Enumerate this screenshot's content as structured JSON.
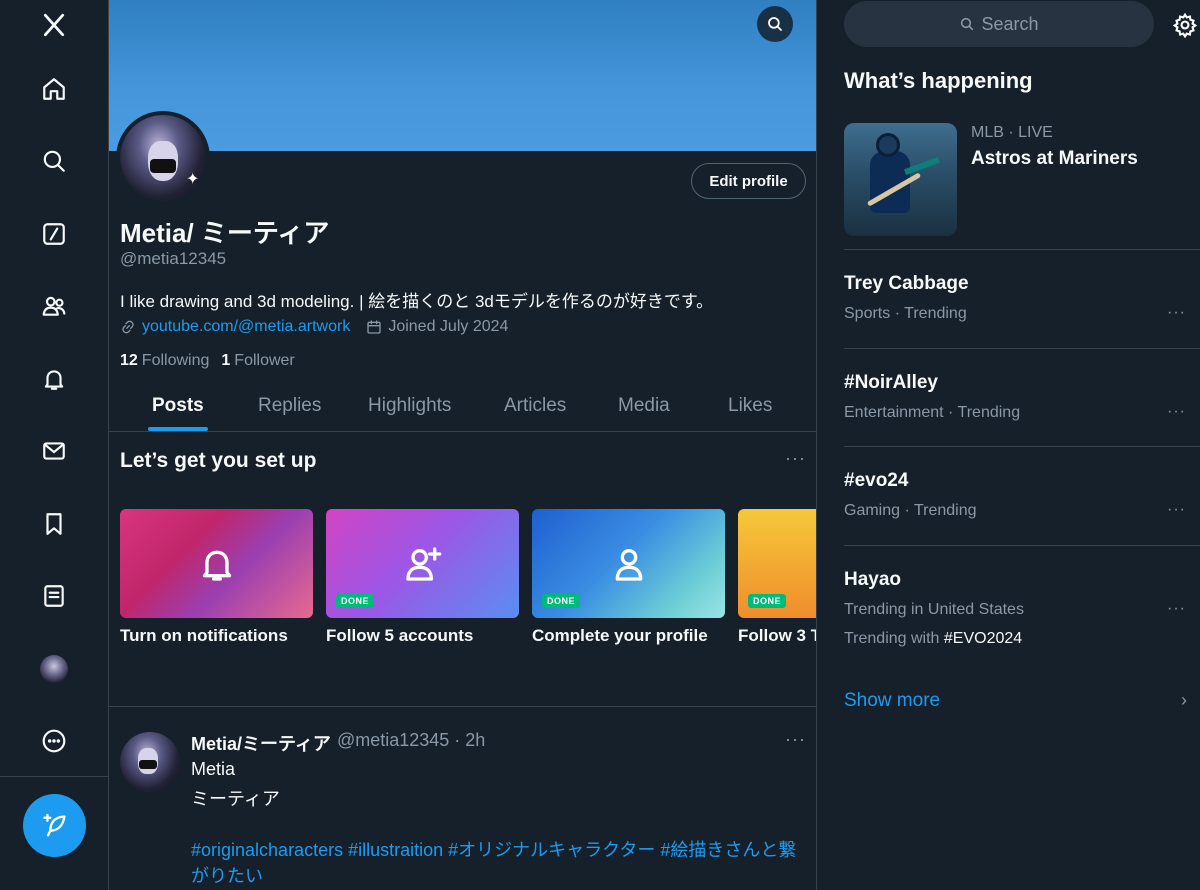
{
  "nav": {
    "compose_label": "Post"
  },
  "profile": {
    "display_name": "Metia/ ミーティア",
    "handle": "@metia12345",
    "bio": "I like drawing and 3d modeling. | 絵を描くのと 3dモデルを作るのが好きです。",
    "link": "youtube.com/@metia.artwork",
    "joined": "Joined July 2024",
    "following_count": "12",
    "following_label": "Following",
    "follower_count": "1",
    "follower_label": "Follower",
    "edit_label": "Edit profile"
  },
  "tabs": [
    "Posts",
    "Replies",
    "Highlights",
    "Articles",
    "Media",
    "Likes"
  ],
  "setup": {
    "title": "Let’s get you set up",
    "more": "···",
    "done_label": "DONE",
    "cards": [
      {
        "label": "Turn on notifications",
        "icon": "bell-icon",
        "done": false
      },
      {
        "label": "Follow 5 accounts",
        "icon": "user-plus-icon",
        "done": true
      },
      {
        "label": "Complete your profile",
        "icon": "user-icon",
        "done": true
      },
      {
        "label": "Follow 3 T",
        "icon": "",
        "done": true
      }
    ]
  },
  "post": {
    "name": "Metia/ミーティア",
    "handle_time": "@metia12345 · 2h",
    "more": "···",
    "line1": "Metia",
    "line2": "ミーティア",
    "tags": "#originalcharacters #illustraition #オリジナルキャラクター #絵描きさんと繋がりたい"
  },
  "right": {
    "search_placeholder": "Search",
    "whats_happening": "What’s happening",
    "mlb": {
      "meta": "MLB · LIVE",
      "title": "Astros at Mariners"
    },
    "trends": [
      {
        "title": "Trey Cabbage",
        "meta": "Sports · Trending"
      },
      {
        "title": "#NoirAlley",
        "meta": "Entertainment · Trending"
      },
      {
        "title": "#evo24",
        "meta": "Gaming · Trending"
      },
      {
        "title": "Hayao",
        "meta": "Trending in United States",
        "extra_prefix": "Trending with ",
        "extra_tag": "#EVO2024"
      }
    ],
    "trend_more": "···",
    "show_more": "Show more",
    "show_more_chevron": "›"
  },
  "colors": {
    "background": "#15202b",
    "accent": "#1d9bf0",
    "secondary_text": "#8b98a5",
    "done_badge": "#00ba7c"
  }
}
